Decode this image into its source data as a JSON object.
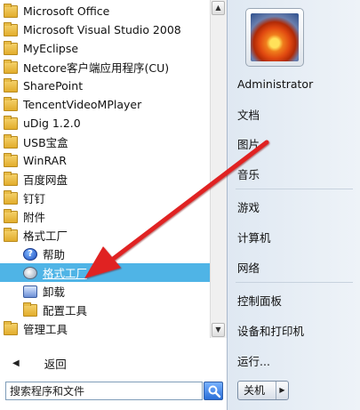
{
  "programs": [
    {
      "label": "Microsoft Office",
      "icon": "folder-icon"
    },
    {
      "label": "Microsoft Visual Studio 2008",
      "icon": "folder-icon"
    },
    {
      "label": "MyEclipse",
      "icon": "folder-icon"
    },
    {
      "label": "Netcore客户端应用程序(CU)",
      "icon": "folder-icon"
    },
    {
      "label": "SharePoint",
      "icon": "folder-icon"
    },
    {
      "label": "TencentVideoMPlayer",
      "icon": "folder-icon"
    },
    {
      "label": "uDig 1.2.0",
      "icon": "folder-icon"
    },
    {
      "label": "USB宝盒",
      "icon": "folder-icon"
    },
    {
      "label": "WinRAR",
      "icon": "folder-icon"
    },
    {
      "label": "百度网盘",
      "icon": "folder-icon"
    },
    {
      "label": "钉钉",
      "icon": "folder-icon"
    },
    {
      "label": "附件",
      "icon": "folder-icon"
    },
    {
      "label": "格式工厂",
      "icon": "folder-icon"
    },
    {
      "label": "帮助",
      "icon": "help-icon"
    },
    {
      "label": "格式工厂",
      "icon": "format-factory-icon"
    },
    {
      "label": "卸载",
      "icon": "uninstall-icon"
    },
    {
      "label": "配置工具",
      "icon": "folder-icon"
    },
    {
      "label": "管理工具",
      "icon": "folder-icon"
    }
  ],
  "back_label": "返回",
  "search": {
    "placeholder": "搜索程序和文件"
  },
  "right_menu": {
    "user": "Administrator",
    "documents": "文档",
    "pictures": "图片",
    "music": "音乐",
    "games": "游戏",
    "computer": "计算机",
    "network": "网络",
    "control_panel": "控制面板",
    "devices_printers": "设备和打印机",
    "run": "运行..."
  },
  "shutdown_label": "关机",
  "colors": {
    "selected": "#4fb4e6",
    "annotation_arrow": "#e02424"
  }
}
